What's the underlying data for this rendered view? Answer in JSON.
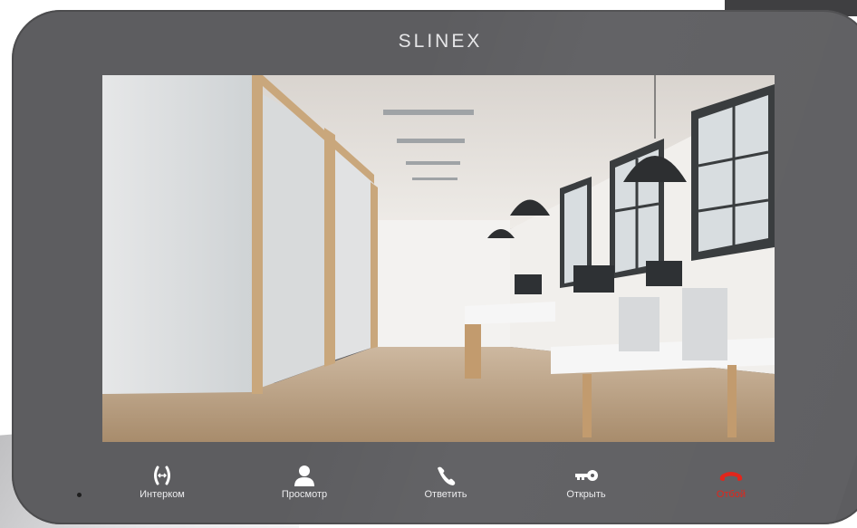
{
  "device": {
    "brand": "SLINEX"
  },
  "controls": [
    {
      "label": "Интерком",
      "icon": "intercom-icon"
    },
    {
      "label": "Просмотр",
      "icon": "person-icon"
    },
    {
      "label": "Ответить",
      "icon": "handset-icon"
    },
    {
      "label": "Открыть",
      "icon": "key-icon"
    },
    {
      "label": "Отбой",
      "icon": "hangup-icon"
    }
  ],
  "colors": {
    "body": "#5d5d60",
    "label": "#ececee",
    "hangup": "#e1261c"
  }
}
